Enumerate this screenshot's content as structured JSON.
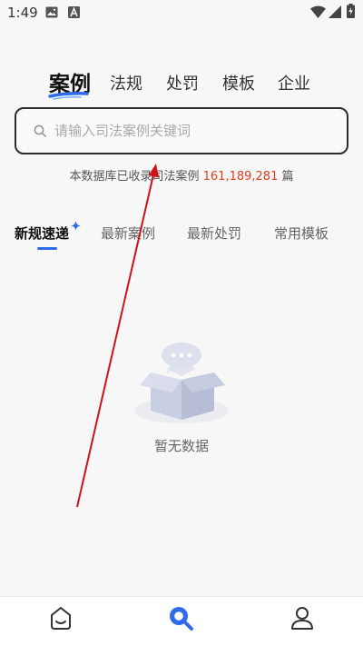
{
  "status_bar": {
    "time": "1:49",
    "left_icons": [
      "gallery-icon",
      "a-badge-icon"
    ],
    "right_icons": [
      "wifi-icon",
      "cellular-icon",
      "battery-charging-icon"
    ]
  },
  "category_tabs": [
    {
      "label": "案例",
      "active": true
    },
    {
      "label": "法规",
      "active": false
    },
    {
      "label": "处罚",
      "active": false
    },
    {
      "label": "模板",
      "active": false
    },
    {
      "label": "企业",
      "active": false
    }
  ],
  "search": {
    "placeholder": "请输入司法案例关键词",
    "value": ""
  },
  "database": {
    "prefix": "本数据库已收录司法案例 ",
    "count": "161,189,281",
    "suffix": " 篇"
  },
  "sub_tabs": [
    {
      "label": "新规速递",
      "active": true
    },
    {
      "label": "最新案例",
      "active": false
    },
    {
      "label": "最新处罚",
      "active": false
    },
    {
      "label": "常用模板",
      "active": false
    }
  ],
  "empty_state": {
    "text": "暂无数据",
    "illustration": "empty-box-illustration"
  },
  "bottom_nav": [
    {
      "icon": "home-face-icon",
      "active": false
    },
    {
      "icon": "search-icon",
      "active": true
    },
    {
      "icon": "user-icon",
      "active": false
    }
  ],
  "colors": {
    "accent_blue": "#2f6bea",
    "count_red": "#e0401f",
    "arrow_red": "#d0121b",
    "background": "#f7f7f7"
  }
}
